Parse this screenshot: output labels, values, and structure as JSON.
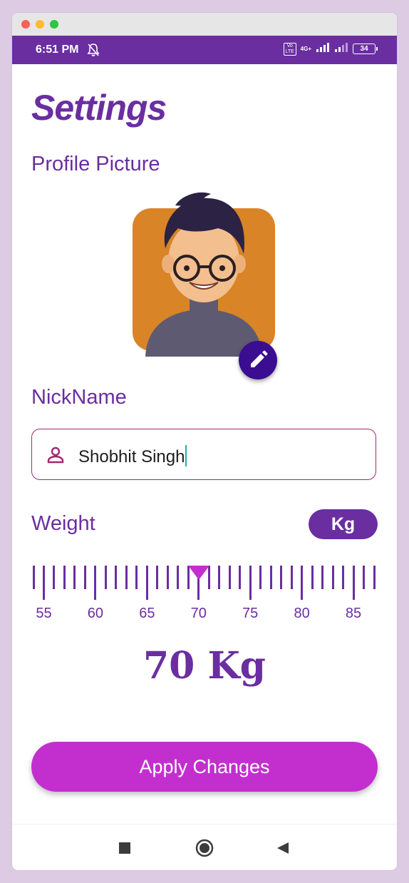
{
  "statusbar": {
    "time": "6:51 PM",
    "volte": "Vo LTE",
    "network": "4G+",
    "battery": "34"
  },
  "page": {
    "title": "Settings",
    "profile_label": "Profile Picture",
    "nickname_label": "NickName",
    "nickname_value": "Shobhit Singh",
    "weight_label": "Weight",
    "unit_button": "Kg",
    "weight_display": "70 Kg",
    "apply_button": "Apply Changes"
  },
  "ruler": {
    "min": 54,
    "max": 87,
    "selected": 70,
    "major_labels": [
      "55",
      "60",
      "65",
      "70",
      "75",
      "80",
      "85"
    ]
  },
  "colors": {
    "primary": "#6a2ea0",
    "accent": "#c32fcf",
    "fab": "#3a0d91",
    "avatar_bg": "#d88427"
  },
  "icons": {
    "edit": "pencil-icon",
    "person": "person-icon",
    "nav_square": "recent-apps-icon",
    "nav_circle": "home-icon",
    "nav_back": "back-icon"
  }
}
